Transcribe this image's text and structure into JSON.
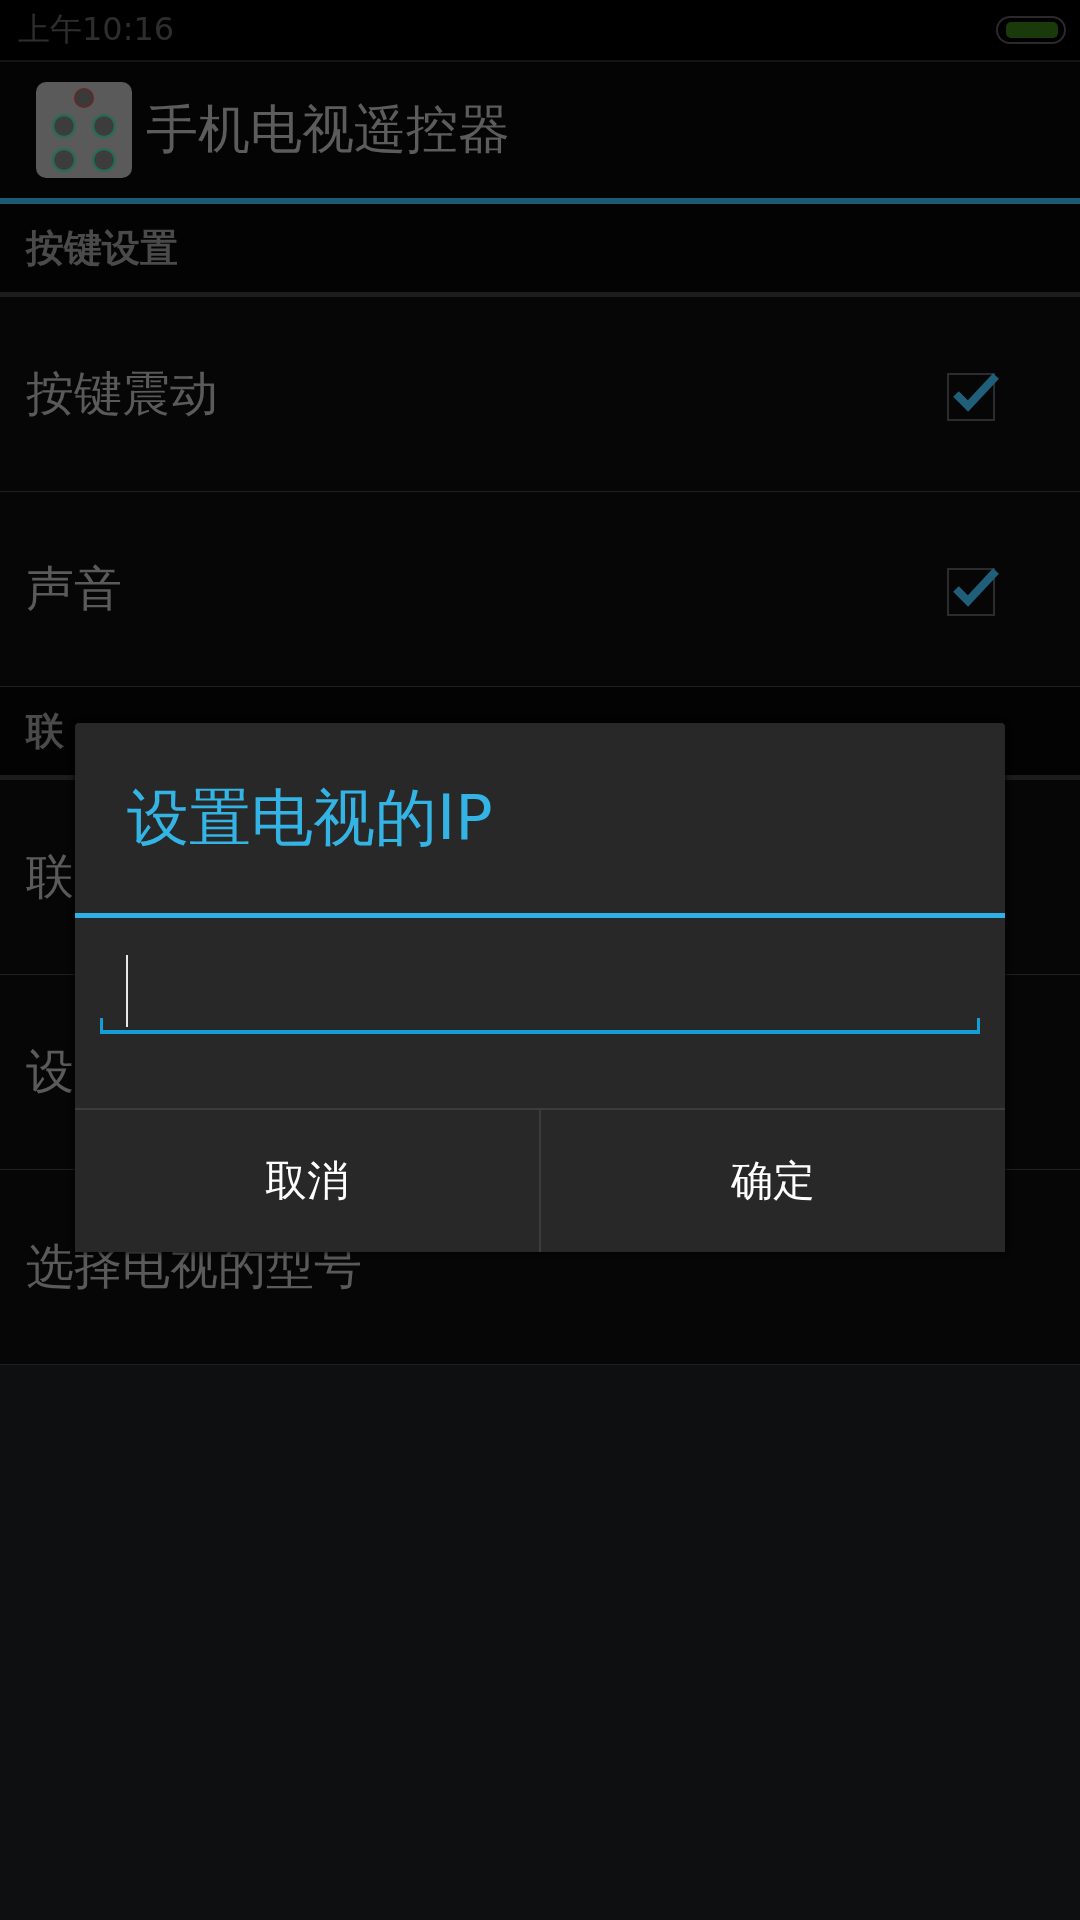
{
  "status_bar": {
    "time": "上午10:16"
  },
  "action_bar": {
    "title": "手机电视遥控器"
  },
  "sections": [
    {
      "header": "按键设置",
      "items": [
        {
          "label": "按键震动",
          "checked": true
        },
        {
          "label": "声音",
          "checked": true
        }
      ]
    },
    {
      "header": "联",
      "items": [
        {
          "label": "联"
        },
        {
          "label": "设"
        },
        {
          "label": "选择电视的型号"
        }
      ]
    }
  ],
  "dialog": {
    "title": "设置电视的IP",
    "buttons": [
      "取消",
      "确定"
    ]
  }
}
